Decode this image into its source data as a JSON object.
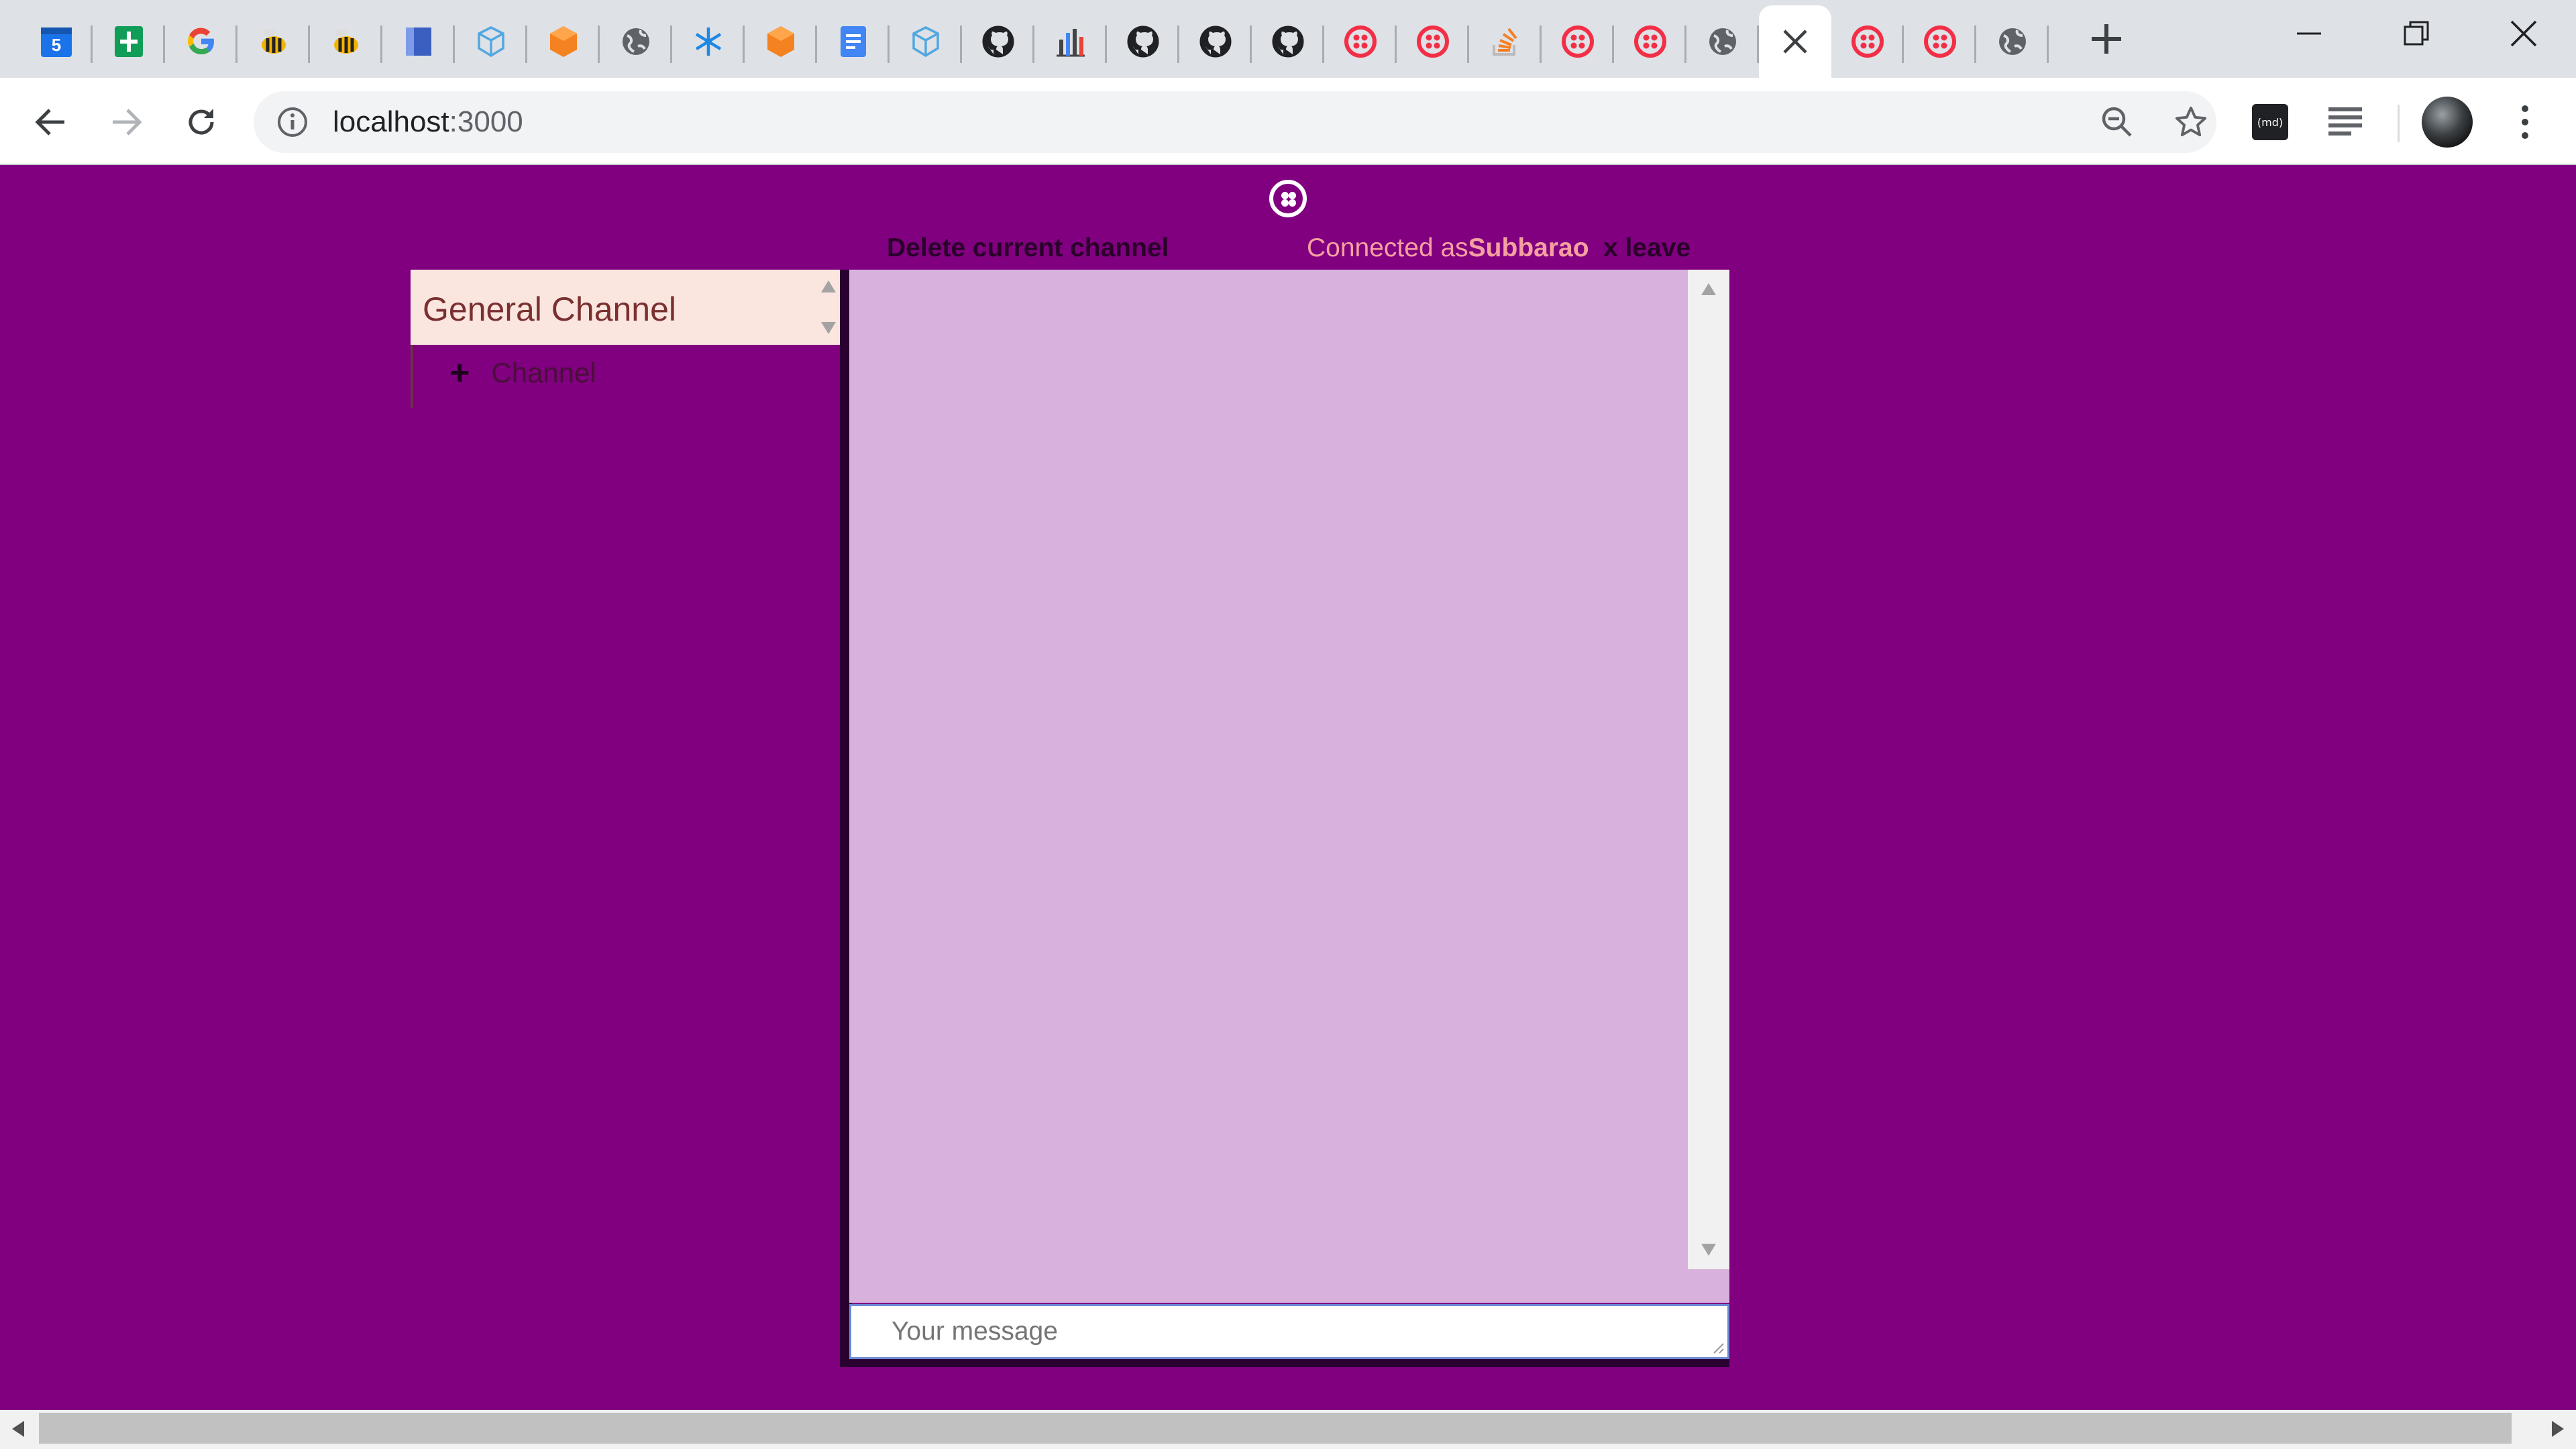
{
  "browser": {
    "tabs": [
      {
        "icon": "calendar-icon",
        "color": "#1a73e8",
        "text": "5"
      },
      {
        "icon": "sheets-icon",
        "color": "#0f9d58"
      },
      {
        "icon": "google-icon",
        "color": "#4285f4"
      },
      {
        "icon": "bee-icon",
        "color": "#f2b400"
      },
      {
        "icon": "bee-icon",
        "color": "#f2b400"
      },
      {
        "icon": "blue-square-icon",
        "color": "#3b5fc0"
      },
      {
        "icon": "box-outline-icon",
        "color": "#52a7e0"
      },
      {
        "icon": "orange-cube-icon",
        "color": "#f58220"
      },
      {
        "icon": "globe-icon",
        "color": "#5f6368"
      },
      {
        "icon": "snowflake-icon",
        "color": "#1e88e5"
      },
      {
        "icon": "orange-cube-icon",
        "color": "#f58220"
      },
      {
        "icon": "docs-icon",
        "color": "#4285f4"
      },
      {
        "icon": "box-outline-icon",
        "color": "#52a7e0"
      },
      {
        "icon": "github-icon",
        "color": "#202124"
      },
      {
        "icon": "bar-chart-icon",
        "color": "#444444"
      },
      {
        "icon": "github-icon",
        "color": "#202124"
      },
      {
        "icon": "github-icon",
        "color": "#202124"
      },
      {
        "icon": "github-icon",
        "color": "#202124"
      },
      {
        "icon": "twilio-icon",
        "color": "#f22f46"
      },
      {
        "icon": "twilio-icon",
        "color": "#f22f46"
      },
      {
        "icon": "stackoverflow-icon",
        "color": "#f48024"
      },
      {
        "icon": "twilio-icon",
        "color": "#f22f46"
      },
      {
        "icon": "twilio-icon",
        "color": "#f22f46"
      },
      {
        "icon": "globe-icon",
        "color": "#5f6368"
      },
      {
        "icon": "close-icon",
        "color": "#3c4043",
        "active": true
      },
      {
        "icon": "twilio-icon",
        "color": "#f22f46"
      },
      {
        "icon": "twilio-icon",
        "color": "#f22f46"
      },
      {
        "icon": "globe-icon",
        "color": "#5f6368"
      }
    ],
    "url_host": "localhost",
    "url_port": ":3000",
    "extension_md_label": "(md)"
  },
  "app": {
    "delete_channel": "Delete current channel",
    "connected_prefix": "Connected as",
    "username": "Subbarao",
    "leave": "x leave",
    "channels": [
      {
        "label": "General Channel"
      }
    ],
    "add_channel_label": "Channel",
    "message_placeholder": "Your message"
  },
  "colors": {
    "page_background": "#800080",
    "channel_item_bg": "#fbe5df",
    "chat_bg": "#d8b2dc",
    "connected_text": "#f5a0a0"
  }
}
